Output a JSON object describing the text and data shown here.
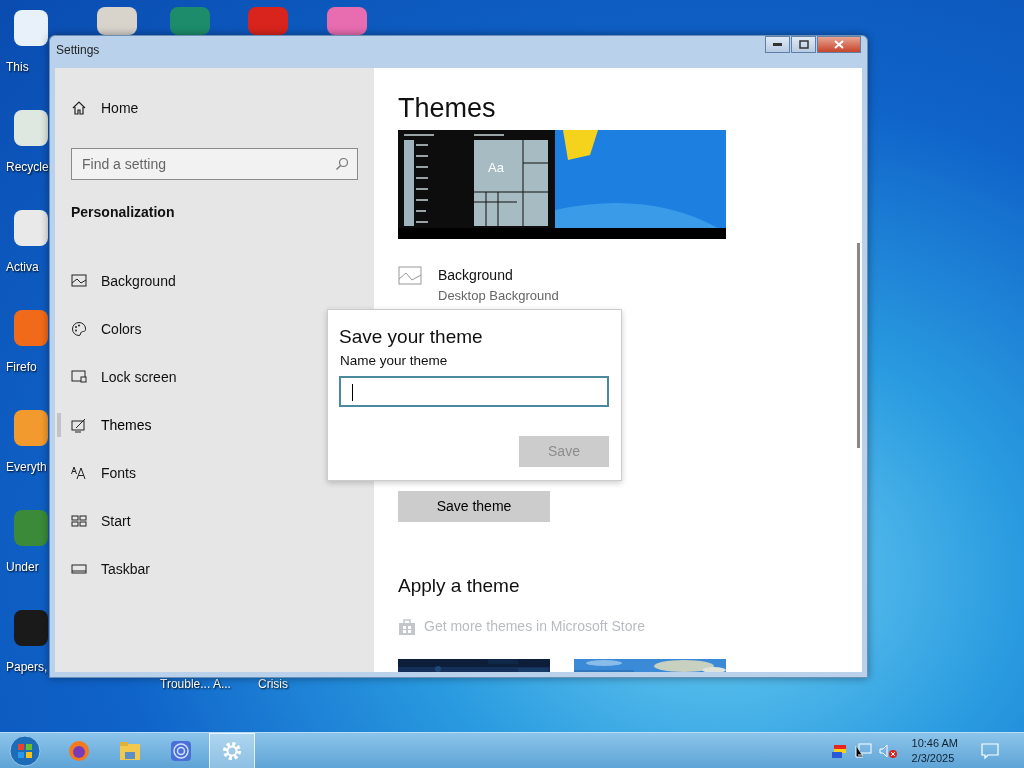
{
  "desktop": {
    "left_icons": [
      {
        "label": "This"
      },
      {
        "label": "Recycle"
      },
      {
        "label": "Activa"
      },
      {
        "label": "Firefo"
      },
      {
        "label": "Everyth"
      },
      {
        "label": "Under"
      },
      {
        "label": "Papers,"
      }
    ],
    "bottom_labels": [
      {
        "label": "Trouble... A..."
      },
      {
        "label": "Crisis"
      }
    ]
  },
  "window": {
    "title": "Settings"
  },
  "sidebar": {
    "home": "Home",
    "search": {
      "placeholder": "Find a setting"
    },
    "section": "Personalization",
    "items": [
      {
        "label": "Background",
        "selected": false
      },
      {
        "label": "Colors",
        "selected": false
      },
      {
        "label": "Lock screen",
        "selected": false
      },
      {
        "label": "Themes",
        "selected": true
      },
      {
        "label": "Fonts",
        "selected": false
      },
      {
        "label": "Start",
        "selected": false
      },
      {
        "label": "Taskbar",
        "selected": false
      }
    ]
  },
  "content": {
    "title": "Themes",
    "preview_tile": "Aa",
    "background": {
      "label": "Background",
      "value": "Desktop Background"
    },
    "save_button": "Save theme",
    "apply_heading": "Apply a theme",
    "store_link": {
      "label": "Get more themes in Microsoft Store",
      "disabled": true
    }
  },
  "dialog": {
    "title": "Save your theme",
    "label": "Name your theme",
    "focused": true,
    "save": {
      "label": "Save",
      "disabled": true
    }
  },
  "taskbar": {
    "apps": [
      {
        "selected": false
      },
      {
        "selected": false
      },
      {
        "selected": false
      },
      {
        "selected": true
      }
    ],
    "time": "10:46 AM",
    "date": "2/3/2025"
  }
}
